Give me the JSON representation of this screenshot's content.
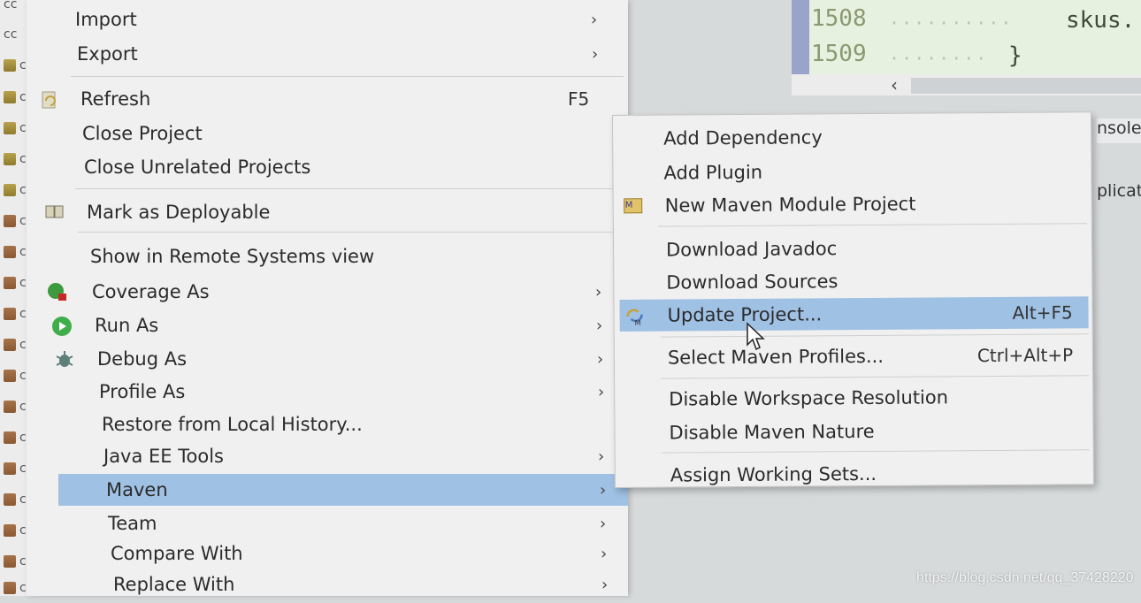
{
  "explorer": {
    "rows": [
      "cc",
      "cc",
      "cc",
      "cc",
      "cc",
      "cc",
      "cc",
      "cc",
      "cc",
      "cc",
      "cc",
      "cc",
      "cc",
      "cc",
      "cc",
      "cc",
      "cc",
      "cc",
      "cc",
      "cc"
    ]
  },
  "editor": {
    "line1": "1508",
    "line2": "1509",
    "code1": "skus.",
    "code2": "}"
  },
  "side_tabs": {
    "console": "nsole",
    "apps": "plicati"
  },
  "menu": {
    "import": "Import",
    "export": "Export",
    "refresh": "Refresh",
    "refresh_shortcut": "F5",
    "close_project": "Close Project",
    "close_unrelated": "Close Unrelated Projects",
    "mark_deployable": "Mark as Deployable",
    "show_remote": "Show in Remote Systems view",
    "coverage_as": "Coverage As",
    "run_as": "Run As",
    "debug_as": "Debug As",
    "profile_as": "Profile As",
    "restore_history": "Restore from Local History...",
    "javaee_tools": "Java EE Tools",
    "maven": "Maven",
    "team": "Team",
    "compare_with": "Compare With",
    "replace_with": "Replace With",
    "arrow": "›"
  },
  "submenu": {
    "add_dependency": "Add Dependency",
    "add_plugin": "Add Plugin",
    "new_module": "New Maven Module Project",
    "download_javadoc": "Download Javadoc",
    "download_sources": "Download Sources",
    "update_project": "Update Project...",
    "update_shortcut": "Alt+F5",
    "select_profiles": "Select Maven Profiles...",
    "profiles_shortcut": "Ctrl+Alt+P",
    "disable_workspace": "Disable Workspace Resolution",
    "disable_nature": "Disable Maven Nature",
    "assign_sets": "Assign Working Sets..."
  },
  "watermark": "https://blog.csdn.net/qq_37428220",
  "colors": {
    "selection": "#9fc1e4",
    "menu_bg": "#f0f0f0"
  }
}
